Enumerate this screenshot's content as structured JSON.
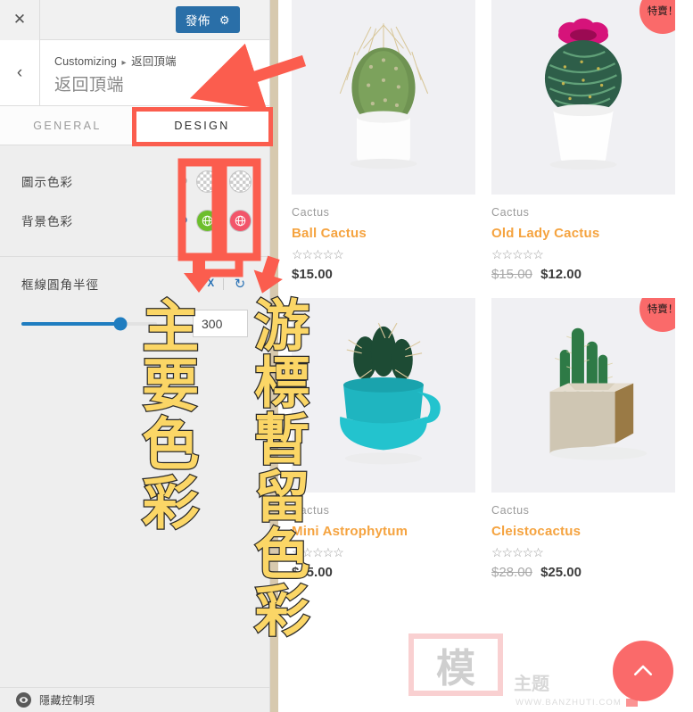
{
  "customizer": {
    "close_icon": "✕",
    "publish_label": "發佈",
    "gear_icon": "⚙",
    "back_icon": "‹",
    "breadcrumb_root": "Customizing",
    "breadcrumb_sep": "▸",
    "breadcrumb_current": "返回頂端",
    "panel_title": "返回頂端",
    "tabs": [
      {
        "label": "GENERAL",
        "active": false
      },
      {
        "label": "DESIGN",
        "active": true
      }
    ],
    "controls": {
      "icon_color_label": "圖示色彩",
      "background_color_label": "背景色彩",
      "reset_icon": "↺",
      "globe_icon": "🌐",
      "swatches": {
        "icon_color_normal": "transparent",
        "icon_color_hover": "transparent",
        "background_color_normal": "#6cbe2c",
        "background_color_hover": "#f2556a"
      },
      "radius_label": "框線圓角半徑",
      "radius_unit": "PX",
      "radius_value": "300",
      "radius_slider_percent": 73
    },
    "footer": {
      "eye_icon": "◉",
      "label": "隱藏控制項"
    }
  },
  "annotations": {
    "primary_color_text": "主要色彩",
    "hover_color_text": "游標暫留色彩"
  },
  "shop": {
    "sale_badge": "特賣！",
    "star_empty": "☆",
    "products": [
      {
        "category": "Cactus",
        "name": "Ball Cactus",
        "stars": "☆☆☆☆☆",
        "price": "$15.00",
        "old_price": "",
        "on_sale": false,
        "art": "ball-cactus"
      },
      {
        "category": "Cactus",
        "name": "Old Lady Cactus",
        "stars": "☆☆☆☆☆",
        "price": "$12.00",
        "old_price": "$15.00",
        "on_sale": true,
        "art": "old-lady-cactus"
      },
      {
        "category": "Cactus",
        "name": "Mini Astrophytum",
        "stars": "☆☆☆☆☆",
        "price": "$45.00",
        "old_price": "",
        "on_sale": false,
        "art": "mini-astrophytum"
      },
      {
        "category": "Cactus",
        "name": "Cleistocactus",
        "stars": "☆☆☆☆☆",
        "price": "$25.00",
        "old_price": "$28.00",
        "on_sale": true,
        "art": "cleistocactus"
      }
    ],
    "scroll_top_icon": "chevron-up"
  },
  "watermark": {
    "seal_char": "模",
    "text": "主题",
    "url": "WWW.BANZHUTI.COM"
  },
  "colors": {
    "accent_blue": "#2a6fa8",
    "annotation_red": "#fb5d4e",
    "product_name_orange": "#f5a33f",
    "sale_red": "#fa6a6a",
    "annotation_yellow": "#fbd666"
  }
}
